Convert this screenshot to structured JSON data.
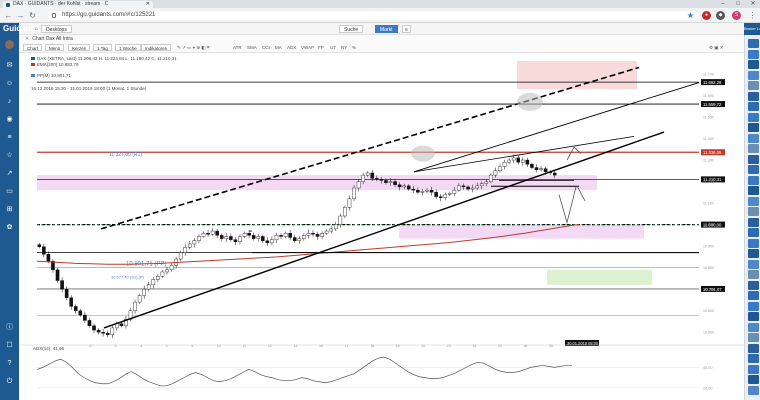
{
  "browser": {
    "tab_title": "DAX · GUIDANTS · der Kohlst · stream · C",
    "url": "https://go.guidants.com/#!c/125221",
    "controls": {
      "minimize": "–",
      "maximize": "□",
      "close": "✕"
    }
  },
  "app": {
    "logo": "Guidants",
    "tab_label": "Chart Dax All Intra",
    "desktop_label": "Desktops",
    "search_label": "Suche",
    "market_label": "Markt",
    "broker_label": "Broker Login"
  },
  "toolbar": {
    "buttons": [
      "Chart",
      "Menü",
      "Kerzen",
      "1 Tag",
      "1 Woche",
      "Indikatoren"
    ],
    "tools": [
      "ATR",
      "SMA",
      "CCI",
      "MA",
      "ADX",
      "VWAP",
      "FP",
      "UT",
      "NY",
      "%"
    ]
  },
  "chart_data": {
    "type": "candlestick",
    "instrument_line": "DAX (XETRA, Last) 11.209,43 H. 11.224,84 L. 11.190,42 C. 11.210,31",
    "legend": [
      {
        "label": "EMA(200) 10.882,79",
        "color": "#c0392b"
      },
      {
        "label": "PP(M) 10.801,71",
        "color": "#4a7fc1"
      }
    ],
    "range_line": "16.12.2016 15:30 - 31.01.2018 18:00 (1 Monat, 1 Stunde)",
    "price_labels": [
      "11.662,28",
      "11.559,72",
      "11.336,05",
      "11.210,31",
      "11.000,00",
      "10.701,07"
    ],
    "pivot_labels": [
      "11.327,80 (R1)",
      "10.801,71 (PP)",
      "10.577,40 (S1) (P)"
    ],
    "time_label": "30.01.2018 08:00",
    "ylim": [
      10450,
      11760
    ],
    "x_ticks": [
      "27",
      "3",
      "4",
      "5",
      "9",
      "10",
      "11",
      "12",
      "13",
      "16",
      "17",
      "18",
      "19",
      "20",
      "23",
      "24",
      "25",
      "26",
      "30"
    ],
    "y_ticks": [
      "11.700",
      "11.600",
      "11.500",
      "11.400",
      "11.300",
      "11.200",
      "11.100",
      "11.000",
      "10.900",
      "10.800",
      "10.700",
      "10.600",
      "10.500"
    ],
    "close": [
      10897,
      10862,
      10830,
      10790,
      10740,
      10700,
      10660,
      10620,
      10600,
      10580,
      10555,
      10530,
      10510,
      10500,
      10495,
      10488,
      10520,
      10540,
      10530,
      10560,
      10600,
      10640,
      10670,
      10700,
      10720,
      10745,
      10760,
      10780,
      10790,
      10810,
      10840,
      10870,
      10895,
      10910,
      10925,
      10945,
      10960,
      10955,
      10970,
      10950,
      10935,
      10945,
      10930,
      10920,
      10945,
      10960,
      10950,
      10935,
      10945,
      10925,
      10915,
      10930,
      10950,
      10945,
      10960,
      10940,
      10925,
      10935,
      10950,
      10960,
      10955,
      10945,
      10960,
      10970,
      10980,
      11000,
      11040,
      11080,
      11120,
      11170,
      11200,
      11230,
      11240,
      11215,
      11210,
      11205,
      11195,
      11200,
      11185,
      11175,
      11180,
      11165,
      11160,
      11150,
      11155,
      11160,
      11150,
      11130,
      11125,
      11140,
      11145,
      11160,
      11180,
      11175,
      11165,
      11170,
      11180,
      11190,
      11200,
      11230,
      11250,
      11270,
      11290,
      11300,
      11310,
      11290,
      11300,
      11280,
      11265,
      11255,
      11260,
      11245,
      11240,
      11230
    ],
    "ema200": [
      10830,
      10828,
      10826,
      10824,
      10822,
      10820,
      10819,
      10818,
      10817,
      10816,
      10816,
      10816,
      10816,
      10817,
      10818,
      10819,
      10820,
      10822,
      10824,
      10826,
      10828,
      10830,
      10832,
      10834,
      10836,
      10838,
      10840,
      10842,
      10844,
      10846,
      10848,
      10850,
      10853,
      10856,
      10859,
      10862,
      10865,
      10868,
      10871,
      10874,
      10877,
      10880,
      10883,
      10886,
      10889,
      10892,
      10895,
      10898,
      10901,
      10904,
      10907,
      10910,
      10913,
      10916,
      10920,
      10924,
      10928,
      10932,
      10936,
      10940,
      10945,
      10950,
      10955,
      10960,
      10966,
      10972,
      10978,
      10984,
      10990,
      10996,
      11000
    ],
    "adx_label": "ADX(14): 41,66",
    "adx_ticks": [
      "40,00",
      "20,00"
    ],
    "adx": [
      38,
      40,
      43,
      46,
      48,
      45,
      40,
      34,
      30,
      27,
      25,
      24,
      24,
      26,
      29,
      33,
      36,
      33,
      29,
      26,
      24,
      22,
      22,
      24,
      27,
      30,
      33,
      35,
      33,
      30,
      27,
      26,
      27,
      29,
      32,
      35,
      38,
      36,
      33,
      31,
      30,
      28,
      27,
      27,
      28,
      30,
      29,
      27,
      26,
      25,
      26,
      28,
      30,
      32,
      34,
      38,
      42,
      46,
      49,
      50,
      48,
      44,
      40,
      36,
      33,
      31,
      30,
      29,
      29,
      30,
      32,
      34,
      37,
      40,
      43,
      45,
      44,
      41,
      38,
      36,
      35,
      35,
      36,
      38,
      40,
      41,
      42,
      41,
      40,
      41,
      42,
      42
    ]
  }
}
